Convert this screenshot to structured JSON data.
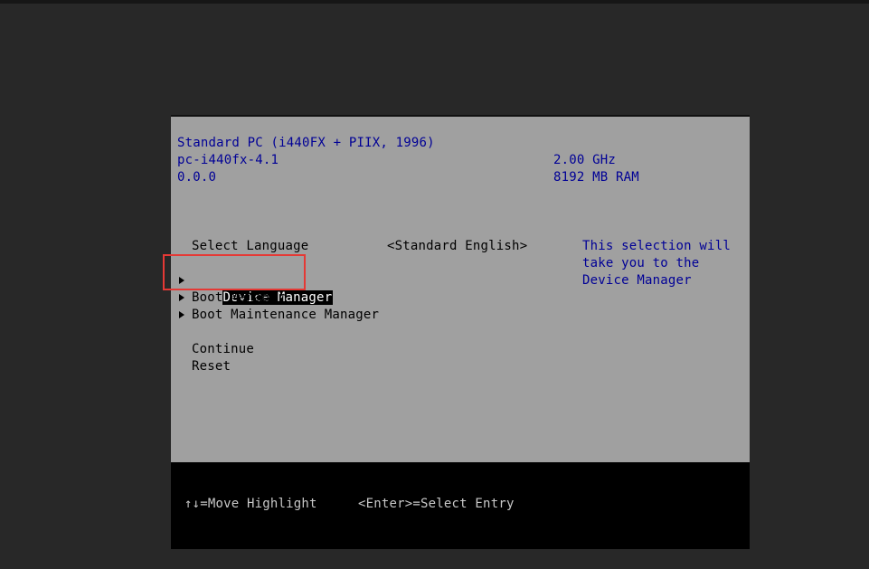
{
  "system_info": {
    "machine": "Standard PC (i440FX + PIIX, 1996)",
    "model": "pc-i440fx-4.1",
    "version": "0.0.0",
    "cpu_speed": "2.00 GHz",
    "memory": "8192 MB RAM"
  },
  "menu": {
    "language_label": "Select Language",
    "language_value": "<Standard English>",
    "items": [
      {
        "label": "Device Manager",
        "selected": true
      },
      {
        "label": "Boot Manager"
      },
      {
        "label": "Boot Maintenance Manager"
      },
      {
        "label": "Continue"
      },
      {
        "label": "Reset"
      }
    ]
  },
  "help_text": {
    "lines": [
      "This selection will",
      "take you to the",
      "Device Manager"
    ]
  },
  "footer": {
    "move_hint": "↑↓=Move Highlight",
    "enter_hint": "<Enter>=Select Entry"
  },
  "colors": {
    "screen_bg": "#a0a0a0",
    "info_text": "#000096",
    "footer_bg": "#000000",
    "annotation": "#e53935"
  }
}
